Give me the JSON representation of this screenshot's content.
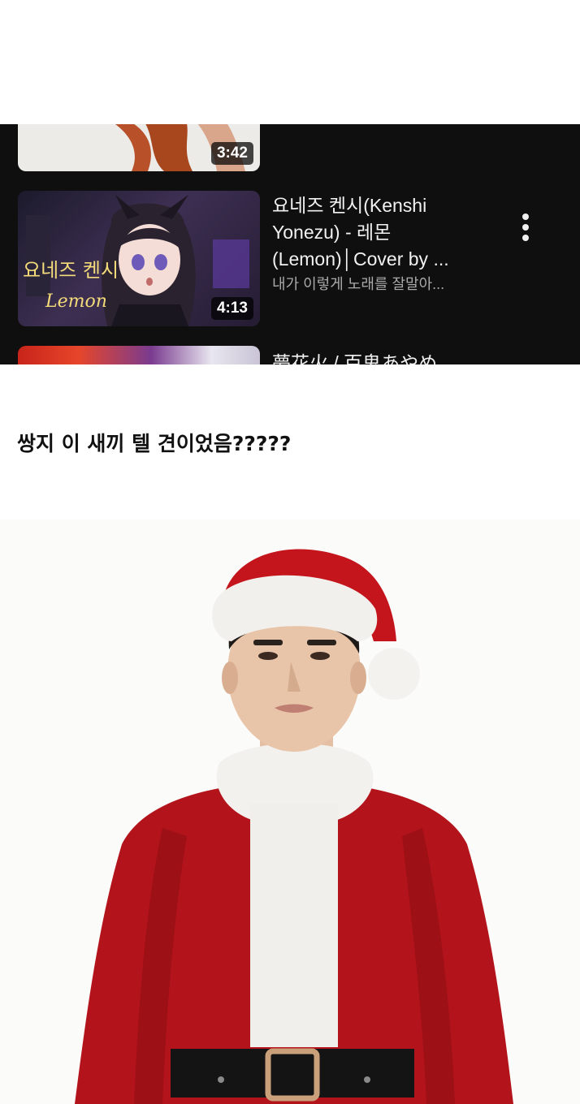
{
  "video_list": {
    "videos": [
      {
        "duration": "3:42"
      },
      {
        "duration": "4:13",
        "title": "요네즈 켄시(Kenshi Yonezu) - 레몬 (Lemon)│Cover by ...",
        "subtitle": "내가 이렇게 노래를 잘말아...",
        "thumb_text": "요네즈 켄시",
        "thumb_text_2": "Lemon"
      },
      {
        "title": "夢花火 / 百鬼あやめ"
      }
    ],
    "menu_icon": "more-vertical-icon"
  },
  "post": {
    "caption": "쌍지 이 새끼 텔 견이었음?????"
  }
}
